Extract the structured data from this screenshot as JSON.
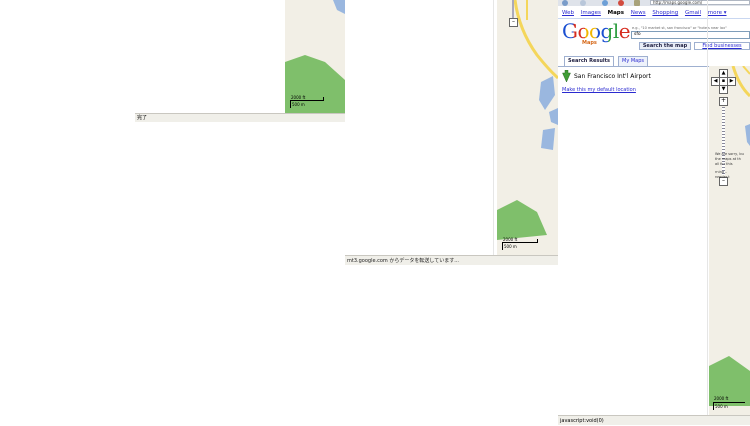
{
  "window1": {
    "scale_ft": "2000 ft",
    "scale_m": "500 m",
    "status": "完了"
  },
  "window2": {
    "scale_ft": "2000 ft",
    "scale_m": "500 m",
    "status": "mt3.google.com からデータを転送しています..."
  },
  "window3": {
    "url": "http://maps.google.com/",
    "nav": {
      "web": "Web",
      "images": "Images",
      "maps": "Maps",
      "news": "News",
      "shopping": "Shopping",
      "gmail": "Gmail",
      "more": "more ▾"
    },
    "logo": {
      "main": "Google",
      "sub": "Maps"
    },
    "search": {
      "hint": "e.g., \"10 market st, san francisco\" or \"hotels near lax\"",
      "value": "sfo",
      "search_button": "Search the map",
      "find_button": "Find businesses"
    },
    "tabs": {
      "results": "Search Results",
      "mymaps": "My Maps"
    },
    "result": {
      "name": "San Francisco Int'l Airport"
    },
    "default_location": "Make this my default location",
    "map_message": [
      "We are sorry, bu",
      "the maps at th",
      "all for this",
      "",
      "rning –",
      "rowder t"
    ],
    "scale_ft": "2000 ft",
    "scale_m": "500 m",
    "status": "javascript:void(0)"
  },
  "colors": {
    "map_land": "#f2efe6",
    "map_green": "#7fbf6b",
    "map_water": "#9ab7df",
    "map_road": "#f4d65b",
    "link": "#2a2ad0"
  }
}
